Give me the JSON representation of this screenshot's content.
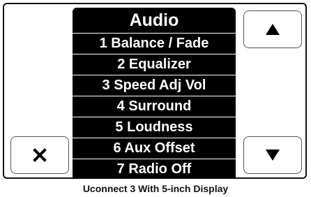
{
  "menu": {
    "title": "Audio",
    "items": [
      "1 Balance / Fade",
      "2 Equalizer",
      "3 Speed Adj Vol",
      "4 Surround",
      "5 Loudness",
      "6 Aux Offset",
      "7 Radio Off"
    ]
  },
  "buttons": {
    "up_icon": "triangle-up-icon",
    "down_icon": "triangle-down-icon",
    "close_icon": "close-icon"
  },
  "caption": "Uconnect 3 With 5-inch Display",
  "colors": {
    "menu_background": "#000000",
    "menu_text": "#ffffff",
    "frame": "#111111"
  }
}
